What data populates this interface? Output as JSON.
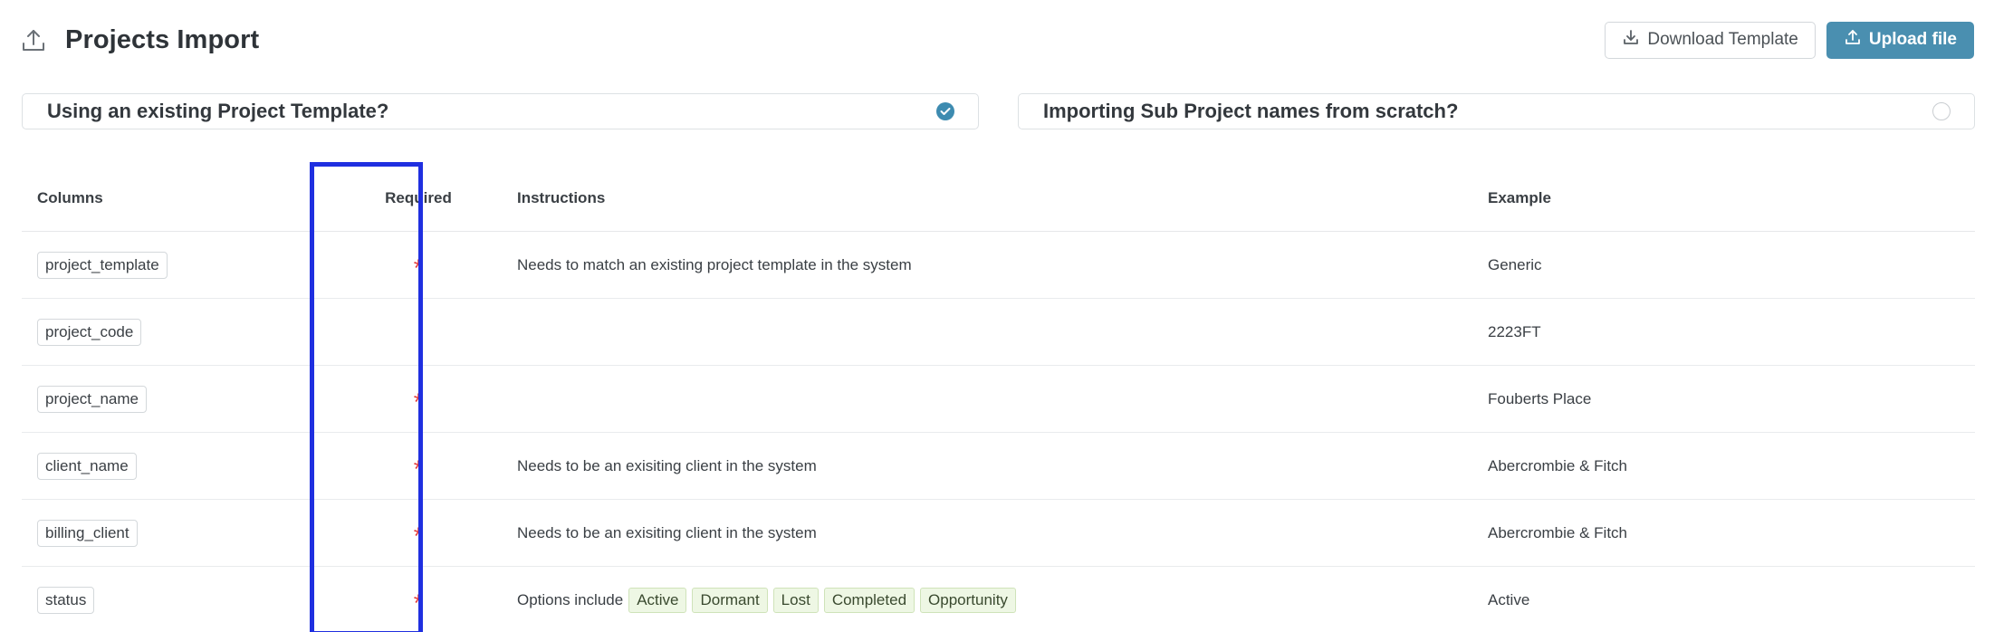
{
  "header": {
    "title": "Projects Import",
    "icon": "upload-icon",
    "download_label": "Download Template",
    "upload_label": "Upload file"
  },
  "options": {
    "existing_template": {
      "label": "Using an existing Project Template?",
      "checked": true
    },
    "from_scratch": {
      "label": "Importing Sub Project names from scratch?",
      "checked": false
    }
  },
  "table": {
    "headers": {
      "columns": "Columns",
      "required": "Required",
      "instructions": "Instructions",
      "example": "Example"
    },
    "rows": [
      {
        "column": "project_template",
        "required": true,
        "instructions": "Needs to match an existing project template in the system",
        "example": "Generic"
      },
      {
        "column": "project_code",
        "required": false,
        "instructions": "",
        "example": "2223FT"
      },
      {
        "column": "project_name",
        "required": true,
        "instructions": "",
        "example": "Fouberts Place"
      },
      {
        "column": "client_name",
        "required": true,
        "instructions": "Needs to be an exisiting client in the system",
        "example": "Abercrombie & Fitch"
      },
      {
        "column": "billing_client",
        "required": true,
        "instructions": "Needs to be an exisiting client in the system",
        "example": "Abercrombie & Fitch"
      },
      {
        "column": "status",
        "required": true,
        "instructions": "Options include",
        "options": [
          "Active",
          "Dormant",
          "Lost",
          "Completed",
          "Opportunity"
        ],
        "example": "Active"
      }
    ],
    "required_marker": "*"
  },
  "colors": {
    "primary": "#4a8fb0",
    "required": "#e23a3a",
    "highlight": "#1f2fe0",
    "chip_bg": "#eef7e4"
  }
}
